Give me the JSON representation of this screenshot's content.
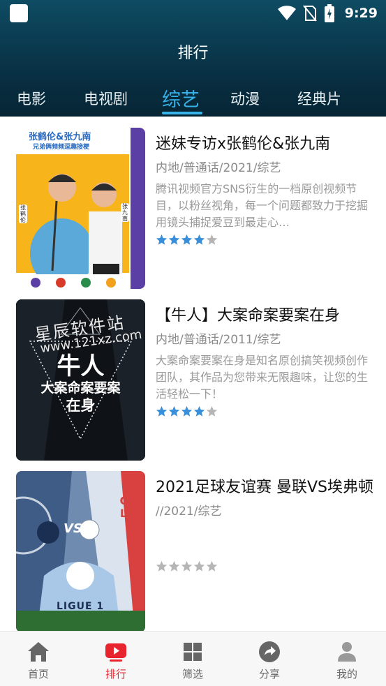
{
  "status": {
    "time": "9:29"
  },
  "header": {
    "title": "排行"
  },
  "tabs": [
    {
      "label": "电影"
    },
    {
      "label": "电视剧"
    },
    {
      "label": "综艺"
    },
    {
      "label": "动漫"
    },
    {
      "label": "经典片"
    }
  ],
  "items": [
    {
      "title": "迷妹专访x张鹤伦&张九南",
      "meta": "内地/普通话/2021/综艺",
      "desc": "腾讯视频官方SNS衍生的一档原创视频节目，以粉丝视角，每一个问题都致力于挖掘用镜头捕捉爱豆到最走心…",
      "rating": 4,
      "poster": {
        "top_text": "张鹤伦&张九南",
        "sub_text": "兄弟俩频频逗趣接梗",
        "left_tag": "张鹤伦",
        "right_tag": "张九南"
      }
    },
    {
      "title": "【牛人】大案命案要案在身",
      "meta": "内地/普通话/2011/综艺",
      "desc": "大案命案要案在身是知名原创搞笑视频创作团队，其作品为您带来无限趣味，让您的生活轻松一下！",
      "rating": 4,
      "poster": {
        "watermark": "星辰软件站",
        "watermark_url": "www.121xz.com",
        "big_text": "牛人",
        "line1": "大案命案要案",
        "line2": "在身"
      }
    },
    {
      "title": "2021足球友谊赛 曼联VS埃弗顿",
      "meta": "//2021/综艺",
      "desc": "",
      "rating": 0,
      "poster": {
        "vs": "VS",
        "league": "LIGUE 1",
        "club": "OLY LYO"
      }
    }
  ],
  "bottom_nav": [
    {
      "label": "首页",
      "icon": "home-icon"
    },
    {
      "label": "排行",
      "icon": "play-icon"
    },
    {
      "label": "筛选",
      "icon": "grid-icon"
    },
    {
      "label": "分享",
      "icon": "share-icon"
    },
    {
      "label": "我的",
      "icon": "user-icon"
    }
  ],
  "colors": {
    "accent": "#35b3ea",
    "nav_active": "#e8242f",
    "star_on": "#3a8fd8",
    "star_off": "#b5b5b5",
    "header_top": "#0e4c63",
    "header_bottom": "#062534"
  }
}
